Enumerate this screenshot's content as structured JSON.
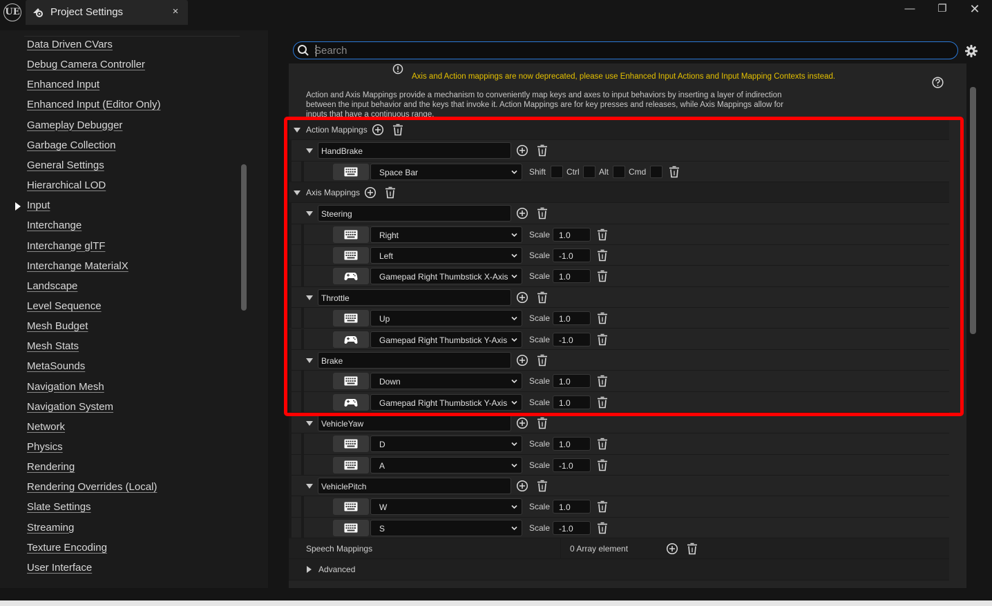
{
  "window": {
    "logo": "UE",
    "tab_title": "Project Settings",
    "tab_close": "×",
    "minimize": "—",
    "restore": "❐",
    "close": "✕"
  },
  "sidebar": {
    "items": [
      {
        "label": "Data Driven CVars"
      },
      {
        "label": "Debug Camera Controller"
      },
      {
        "label": "Enhanced Input"
      },
      {
        "label": "Enhanced Input (Editor Only)"
      },
      {
        "label": "Gameplay Debugger"
      },
      {
        "label": "Garbage Collection"
      },
      {
        "label": "General Settings"
      },
      {
        "label": "Hierarchical LOD"
      },
      {
        "label": "Input",
        "selected": true
      },
      {
        "label": "Interchange"
      },
      {
        "label": "Interchange glTF"
      },
      {
        "label": "Interchange MaterialX"
      },
      {
        "label": "Landscape"
      },
      {
        "label": "Level Sequence"
      },
      {
        "label": "Mesh Budget"
      },
      {
        "label": "Mesh Stats"
      },
      {
        "label": "MetaSounds"
      },
      {
        "label": "Navigation Mesh"
      },
      {
        "label": "Navigation System"
      },
      {
        "label": "Network"
      },
      {
        "label": "Physics"
      },
      {
        "label": "Rendering"
      },
      {
        "label": "Rendering Overrides (Local)"
      },
      {
        "label": "Slate Settings"
      },
      {
        "label": "Streaming"
      },
      {
        "label": "Texture Encoding"
      },
      {
        "label": "User Interface"
      }
    ]
  },
  "search": {
    "placeholder": "Search",
    "value": ""
  },
  "warning": "Axis and Action mappings are now deprecated, please use Enhanced Input Actions and Input Mapping Contexts instead.",
  "description": "Action and Axis Mappings provide a mechanism to conveniently map keys and axes to input behaviors by inserting a layer of indirection between the input behavior and the keys that invoke it. Action Mappings are for key presses and releases, while Axis Mappings allow for inputs that have a continuous range.",
  "action_mappings": {
    "label": "Action Mappings",
    "groups": [
      {
        "name": "HandBrake",
        "keys": [
          {
            "device": "keyboard",
            "key": "Space Bar",
            "modifiers": [
              "Shift",
              "Ctrl",
              "Alt",
              "Cmd"
            ]
          }
        ]
      }
    ]
  },
  "axis_mappings": {
    "label": "Axis Mappings",
    "scale_label": "Scale",
    "groups": [
      {
        "name": "Steering",
        "keys": [
          {
            "device": "keyboard",
            "key": "Right",
            "scale": "1.0"
          },
          {
            "device": "keyboard",
            "key": "Left",
            "scale": "-1.0"
          },
          {
            "device": "gamepad",
            "key": "Gamepad Right Thumbstick X-Axis",
            "scale": "1.0"
          }
        ]
      },
      {
        "name": "Throttle",
        "keys": [
          {
            "device": "keyboard",
            "key": "Up",
            "scale": "1.0"
          },
          {
            "device": "gamepad",
            "key": "Gamepad Right Thumbstick Y-Axis",
            "scale": "-1.0"
          }
        ]
      },
      {
        "name": "Brake",
        "keys": [
          {
            "device": "keyboard",
            "key": "Down",
            "scale": "1.0"
          },
          {
            "device": "gamepad",
            "key": "Gamepad Right Thumbstick Y-Axis",
            "scale": "1.0"
          }
        ]
      },
      {
        "name": "VehicleYaw",
        "keys": [
          {
            "device": "keyboard",
            "key": "D",
            "scale": "1.0"
          },
          {
            "device": "keyboard",
            "key": "A",
            "scale": "-1.0"
          }
        ]
      },
      {
        "name": "VehiclePitch",
        "keys": [
          {
            "device": "keyboard",
            "key": "W",
            "scale": "1.0"
          },
          {
            "device": "keyboard",
            "key": "S",
            "scale": "-1.0"
          }
        ]
      }
    ]
  },
  "speech_mappings": {
    "label": "Speech Mappings",
    "value": "0 Array element"
  },
  "advanced": {
    "label": "Advanced"
  },
  "colors": {
    "accent": "#2a79d8",
    "highlight": "#ff0000",
    "warning": "#e5c100",
    "background": "#151515"
  },
  "icons": [
    "unreal-logo",
    "settings-tab-icon",
    "search-icon",
    "gear-icon",
    "warning-icon",
    "help-icon",
    "add-icon",
    "trash-icon",
    "keyboard-icon",
    "gamepad-icon",
    "chevron-down-icon"
  ]
}
